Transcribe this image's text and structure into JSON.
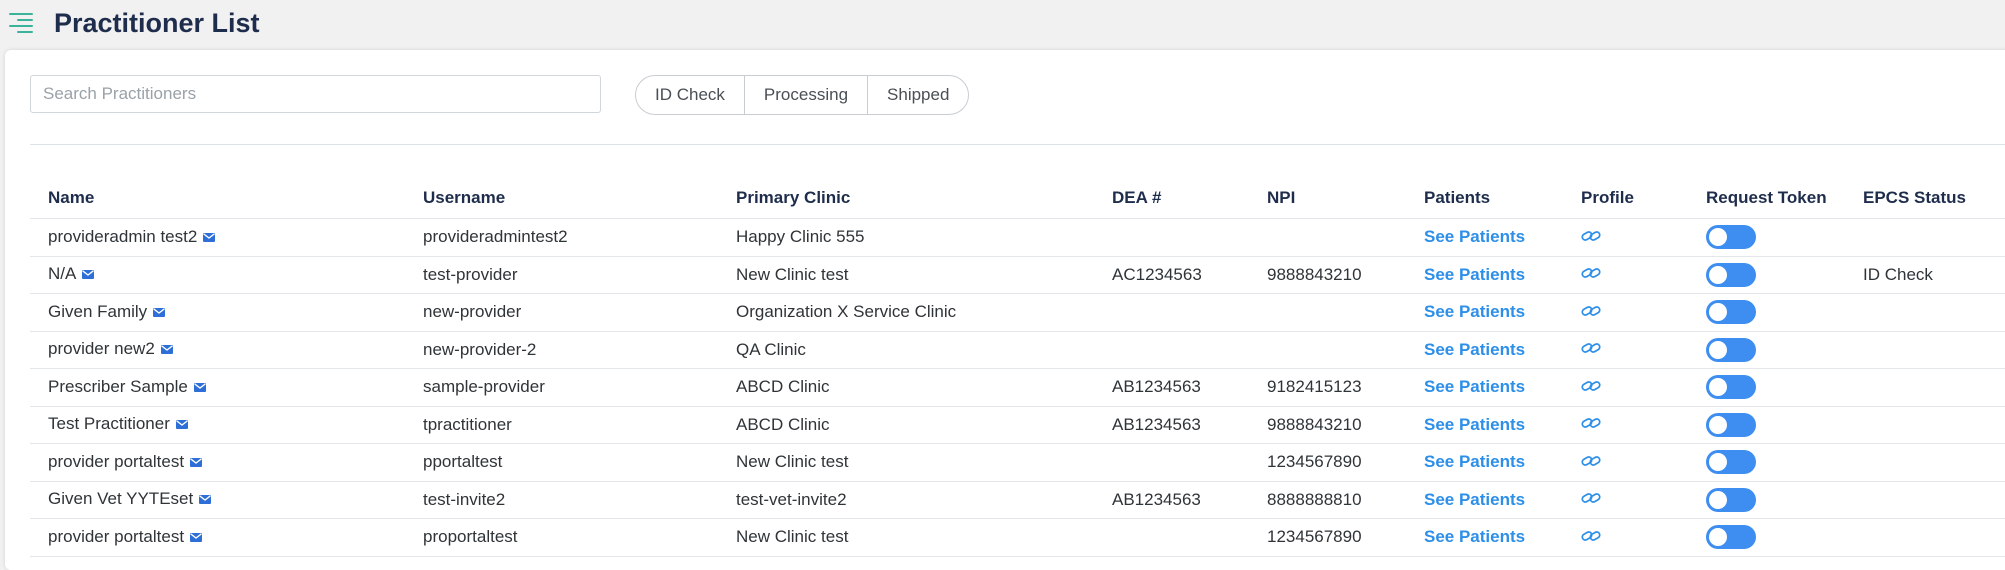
{
  "header": {
    "title": "Practitioner List"
  },
  "search": {
    "placeholder": "Search Practitioners",
    "value": ""
  },
  "filters": [
    "ID Check",
    "Processing",
    "Shipped"
  ],
  "table": {
    "columns": [
      "Name",
      "Username",
      "Primary Clinic",
      "DEA #",
      "NPI",
      "Patients",
      "Profile",
      "Request Token",
      "EPCS Status"
    ],
    "rows": [
      {
        "name": "provideradmin test2",
        "username": "provideradmintest2",
        "clinic": "Happy Clinic 555",
        "dea": "",
        "npi": "",
        "patients": "See Patients",
        "request_token": false,
        "epcs": ""
      },
      {
        "name": "N/A",
        "username": "test-provider",
        "clinic": "New Clinic test",
        "dea": "AC1234563",
        "npi": "9888843210",
        "patients": "See Patients",
        "request_token": false,
        "epcs": "ID Check"
      },
      {
        "name": "Given Family",
        "username": "new-provider",
        "clinic": "Organization X Service Clinic",
        "dea": "",
        "npi": "",
        "patients": "See Patients",
        "request_token": false,
        "epcs": ""
      },
      {
        "name": "provider new2",
        "username": "new-provider-2",
        "clinic": "QA Clinic",
        "dea": "",
        "npi": "",
        "patients": "See Patients",
        "request_token": false,
        "epcs": ""
      },
      {
        "name": "Prescriber Sample",
        "username": "sample-provider",
        "clinic": "ABCD Clinic",
        "dea": "AB1234563",
        "npi": "9182415123",
        "patients": "See Patients",
        "request_token": false,
        "epcs": ""
      },
      {
        "name": "Test Practitioner",
        "username": "tpractitioner",
        "clinic": "ABCD Clinic",
        "dea": "AB1234563",
        "npi": "9888843210",
        "patients": "See Patients",
        "request_token": false,
        "epcs": ""
      },
      {
        "name": "provider portaltest",
        "username": "pportaltest",
        "clinic": "New Clinic test",
        "dea": "",
        "npi": "1234567890",
        "patients": "See Patients",
        "request_token": false,
        "epcs": ""
      },
      {
        "name": "Given Vet YYTEset",
        "username": "test-invite2",
        "clinic": "test-vet-invite2",
        "dea": "AB1234563",
        "npi": "8888888810",
        "patients": "See Patients",
        "request_token": false,
        "epcs": ""
      },
      {
        "name": "provider portaltest",
        "username": "proportaltest",
        "clinic": "New Clinic test",
        "dea": "",
        "npi": "1234567890",
        "patients": "See Patients",
        "request_token": false,
        "epcs": ""
      }
    ]
  },
  "icons": {
    "menu": "menu-icon",
    "mail": "envelope-icon",
    "profile": "link-icon"
  },
  "colors": {
    "accent": "#3d8ef0",
    "link": "#2d8fe8",
    "menu": "#3bb39a",
    "title": "#1f2d4d"
  }
}
